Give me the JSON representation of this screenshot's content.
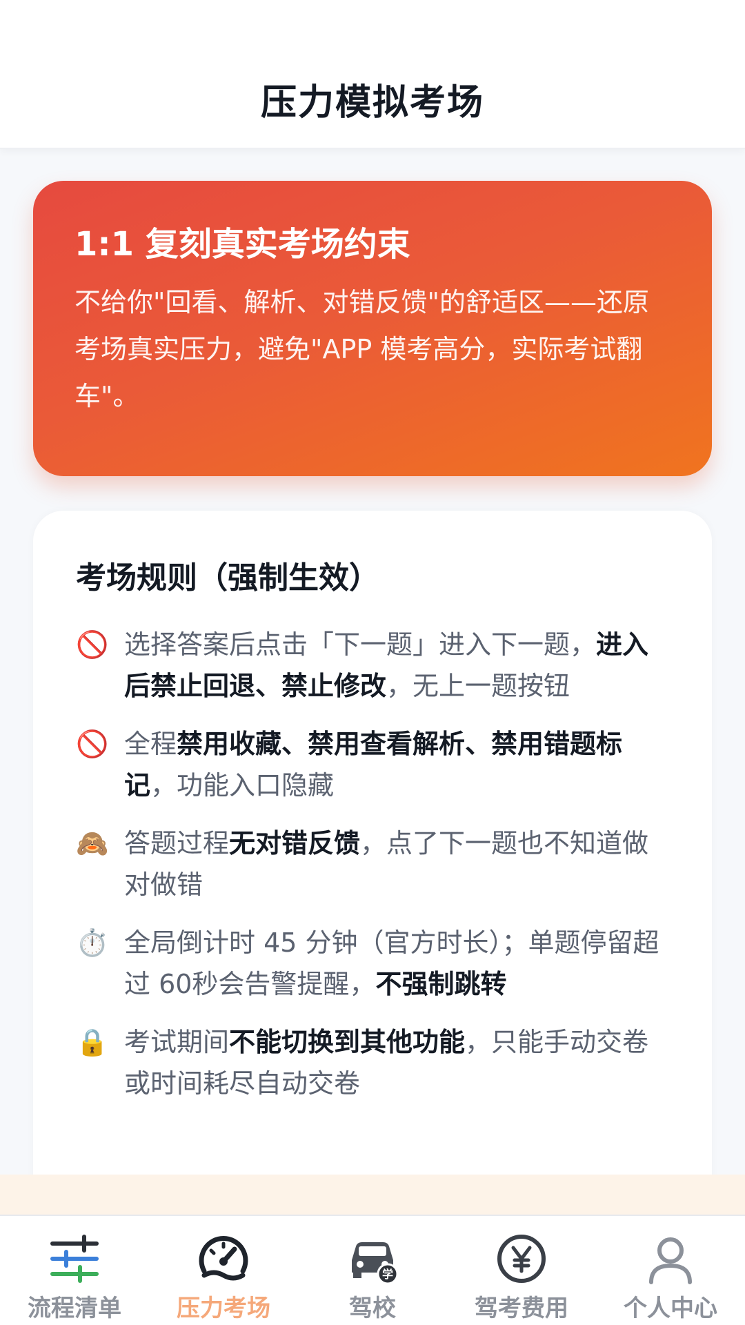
{
  "header": {
    "title": "压力模拟考场"
  },
  "hero": {
    "title": "1:1 复刻真实考场约束",
    "description": "不给你\"回看、解析、对错反馈\"的舒适区——还原考场真实压力，避免\"APP 模考高分，实际考试翻车\"。"
  },
  "rules": {
    "title": "考场规则（强制生效）",
    "items": [
      {
        "icon": "prohibited-icon",
        "glyph": "🚫",
        "parts": [
          {
            "text": "选择答案后点击「下一题」进入下一题，",
            "bold": false
          },
          {
            "text": "进入后禁止回退、禁止修改",
            "bold": true
          },
          {
            "text": "，无上一题按钮",
            "bold": false
          }
        ]
      },
      {
        "icon": "prohibited-icon",
        "glyph": "🚫",
        "parts": [
          {
            "text": "全程",
            "bold": false
          },
          {
            "text": "禁用收藏、禁用查看解析、禁用错题标记",
            "bold": true
          },
          {
            "text": "，功能入口隐藏",
            "bold": false
          }
        ]
      },
      {
        "icon": "see-no-evil-monkey-icon",
        "glyph": "🙈",
        "parts": [
          {
            "text": "答题过程",
            "bold": false
          },
          {
            "text": "无对错反馈",
            "bold": true
          },
          {
            "text": "，点了下一题也不知道做对做错",
            "bold": false
          }
        ]
      },
      {
        "icon": "stopwatch-icon",
        "glyph": "⏱️",
        "parts": [
          {
            "text": "全局倒计时 45 分钟（官方时长）；单题停留超过 60秒会告警提醒，",
            "bold": false
          },
          {
            "text": "不强制跳转",
            "bold": true
          }
        ]
      },
      {
        "icon": "lock-icon",
        "glyph": "🔒",
        "parts": [
          {
            "text": "考试期间",
            "bold": false
          },
          {
            "text": "不能切换到其他功能",
            "bold": true
          },
          {
            "text": "，只能手动交卷或时间耗尽自动交卷",
            "bold": false
          }
        ]
      }
    ]
  },
  "tabbar": {
    "active_color": "#f5a87a",
    "inactive_color": "#8c919a",
    "items": [
      {
        "label": "流程清单",
        "icon": "sliders-icon",
        "active": false
      },
      {
        "label": "压力考场",
        "icon": "speedometer-icon",
        "active": true
      },
      {
        "label": "驾校",
        "icon": "car-school-icon",
        "active": false
      },
      {
        "label": "驾考费用",
        "icon": "yen-coin-icon",
        "active": false
      },
      {
        "label": "个人中心",
        "icon": "user-icon",
        "active": false
      }
    ]
  }
}
